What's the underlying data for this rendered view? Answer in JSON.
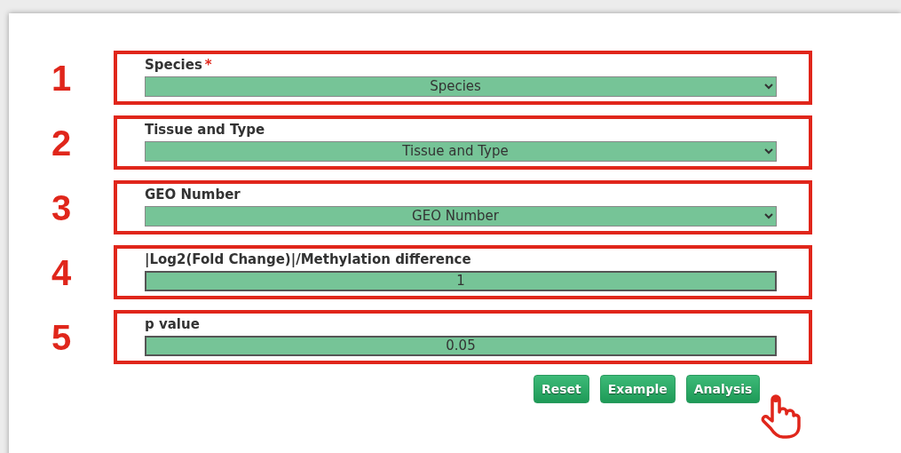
{
  "fields": [
    {
      "number": "1",
      "label": "Species",
      "required_mark": "*",
      "kind": "select",
      "value": "Species"
    },
    {
      "number": "2",
      "label": "Tissue and Type",
      "kind": "select",
      "value": "Tissue and Type"
    },
    {
      "number": "3",
      "label": "GEO Number",
      "kind": "select",
      "value": "GEO Number"
    },
    {
      "number": "4",
      "label": "|Log2(Fold Change)|/Methylation difference",
      "kind": "input",
      "value": "1"
    },
    {
      "number": "5",
      "label": "p value",
      "kind": "input",
      "value": "0.05"
    }
  ],
  "buttons": [
    "Reset",
    "Example",
    "Analysis"
  ]
}
